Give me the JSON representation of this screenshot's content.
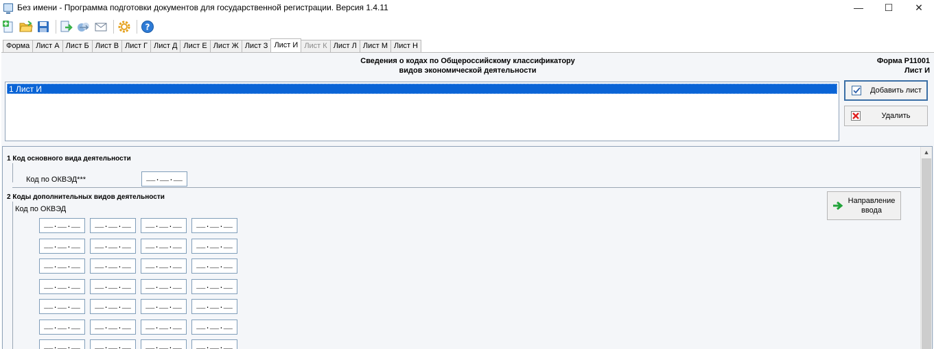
{
  "window": {
    "title": "Без имени - Программа подготовки документов для государственной регистрации. Версия 1.4.11",
    "controls": [
      "—",
      "☐",
      "✕"
    ]
  },
  "toolbar": {
    "buttons": [
      "new-doc-icon",
      "open-folder-icon",
      "save-disk-icon",
      "export-icon",
      "send-icon",
      "mail-icon",
      "settings-gear-icon",
      "help-icon"
    ]
  },
  "tabs": [
    {
      "label": "Форма",
      "state": "normal"
    },
    {
      "label": "Лист А",
      "state": "normal"
    },
    {
      "label": "Лист Б",
      "state": "normal"
    },
    {
      "label": "Лист В",
      "state": "normal"
    },
    {
      "label": "Лист Г",
      "state": "normal"
    },
    {
      "label": "Лист Д",
      "state": "normal"
    },
    {
      "label": "Лист Е",
      "state": "normal"
    },
    {
      "label": "Лист Ж",
      "state": "normal"
    },
    {
      "label": "Лист З",
      "state": "normal"
    },
    {
      "label": "Лист И",
      "state": "active"
    },
    {
      "label": "Лист К",
      "state": "disabled"
    },
    {
      "label": "Лист Л",
      "state": "normal"
    },
    {
      "label": "Лист М",
      "state": "normal"
    },
    {
      "label": "Лист Н",
      "state": "normal"
    }
  ],
  "header": {
    "line1": "Сведения о кодах по Общероссийскому классификатору",
    "line2": "видов экономической деятельности",
    "form_code": "Форма Р11001",
    "sheet": "Лист И"
  },
  "sheet_list": {
    "items": [
      "1 Лист И"
    ]
  },
  "actions": {
    "add_label": "Добавить лист",
    "delete_label": "Удалить"
  },
  "section1": {
    "title": "1   Код основного вида деятельности",
    "field_label": "Код по ОКВЭД***",
    "value": "__.__.__"
  },
  "section2": {
    "title": "2   Коды дополнительных видов деятельности",
    "field_label": "Код по ОКВЭД",
    "direction_line1": "Направление",
    "direction_line2": "ввода",
    "mask": "__.__.__",
    "rows": 7,
    "cols": 4
  },
  "colors": {
    "selection": "#0a64d6",
    "panel_bg": "#f4f6f9",
    "border": "#8fa2b8"
  }
}
